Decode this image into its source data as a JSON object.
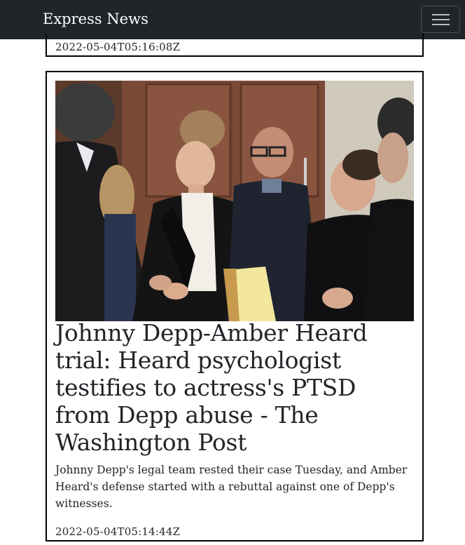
{
  "navbar": {
    "brand": "Express News",
    "toggle_icon": "hamburger-menu-icon"
  },
  "previous_article": {
    "timestamp": "2022-05-04T05:16:08Z"
  },
  "article": {
    "image_alt": "Amber Heard in courtroom with attorneys",
    "headline": "Johnny Depp-Amber Heard trial: Heard psychologist testifies to actress's PTSD from Depp abuse - The Washington Post",
    "description": "Johnny Depp's legal team rested their case Tuesday, and Amber Heard's defense started with a rebuttal against one of Depp's witnesses.",
    "timestamp": "2022-05-04T05:14:44Z"
  }
}
